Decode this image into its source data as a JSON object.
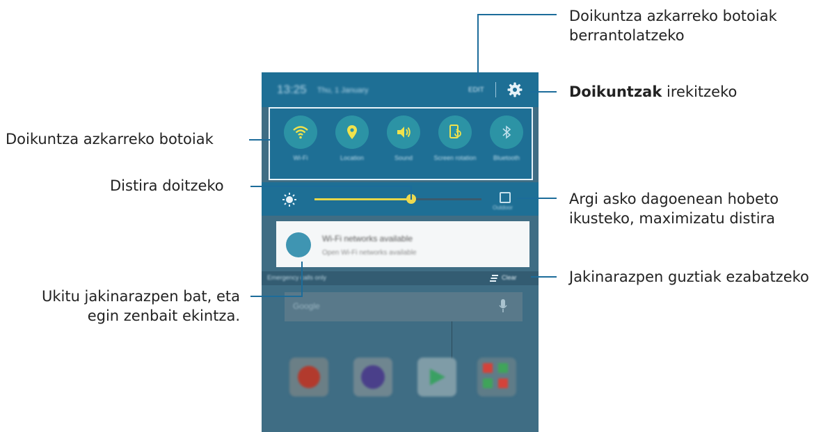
{
  "callouts": {
    "rearrange": "Doikuntza azkarreko botoiak berrantolatzeko",
    "settings_bold": "Doikuntzak",
    "settings_rest": " irekitzeko",
    "quick_buttons": "Doikuntza azkarreko botoiak",
    "brightness": "Distira doitzeko",
    "outdoor": "Argi asko dagoenean hobeto ikusteko, maximizatu distira",
    "notification": "Ukitu jakinarazpen bat, eta egin zenbait ekintza.",
    "clear_all": "Jakinarazpen guztiak ezabatzeko"
  },
  "status_bar": {
    "time": "13:25",
    "date": "Thu, 1 January",
    "edit_label": "EDIT",
    "settings_icon": "gear-icon"
  },
  "quick_settings": [
    {
      "label": "Wi-Fi",
      "icon": "wifi-icon"
    },
    {
      "label": "Location",
      "icon": "location-icon"
    },
    {
      "label": "Sound",
      "icon": "sound-icon"
    },
    {
      "label": "Screen rotation",
      "icon": "screen-rotation-icon"
    },
    {
      "label": "Bluetooth",
      "icon": "bluetooth-icon"
    }
  ],
  "brightness": {
    "level": 0.58,
    "outdoor_label": "Outdoor",
    "icon": "brightness-icon"
  },
  "notification": {
    "title": "Wi-Fi networks available",
    "text": "Open Wi-Fi networks available",
    "icon": "wifi-notification-icon"
  },
  "footer_bar": {
    "emergency_text": "Emergency calls only",
    "clear_label": "Clear"
  },
  "home": {
    "search_label": "Google",
    "apps": [
      {
        "label": "",
        "icon": "red-app-icon"
      },
      {
        "label": "",
        "icon": "camera-icon"
      },
      {
        "label": "",
        "icon": "play-store-icon"
      },
      {
        "label": "",
        "icon": "apps-folder-icon"
      }
    ]
  },
  "colors": {
    "accent": "#1e6f95",
    "leader_line": "#1c6c9a",
    "slider": "#e8d84a"
  }
}
